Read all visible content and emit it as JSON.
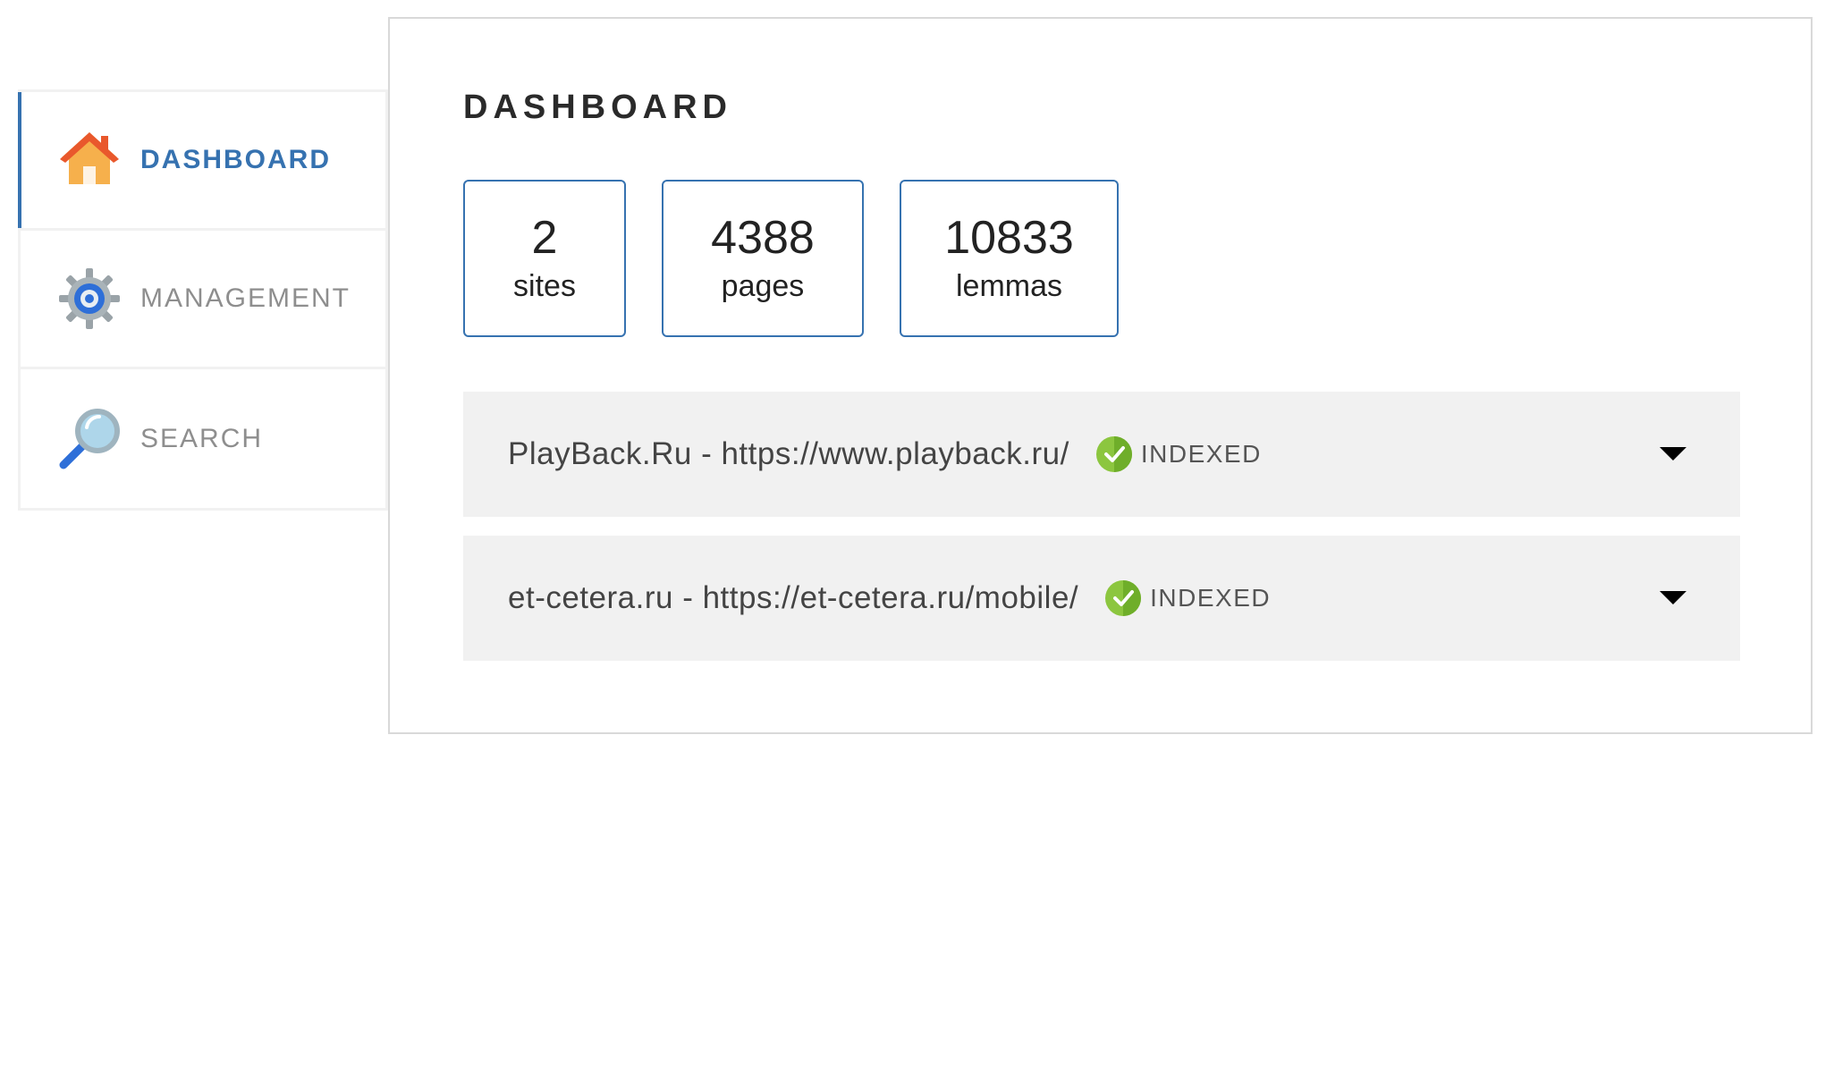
{
  "nav": {
    "items": [
      {
        "label": "DASHBOARD",
        "icon": "home-icon",
        "active": true
      },
      {
        "label": "MANAGEMENT",
        "icon": "gear-icon",
        "active": false
      },
      {
        "label": "SEARCH",
        "icon": "magnifier-icon",
        "active": false
      }
    ]
  },
  "main": {
    "title": "DASHBOARD",
    "stats": [
      {
        "value": "2",
        "label": "sites"
      },
      {
        "value": "4388",
        "label": "pages"
      },
      {
        "value": "10833",
        "label": "lemmas"
      }
    ],
    "sites": [
      {
        "text": "PlayBack.Ru - https://www.playback.ru/",
        "status": "INDEXED"
      },
      {
        "text": "et-cetera.ru - https://et-cetera.ru/mobile/",
        "status": "INDEXED"
      }
    ]
  },
  "colors": {
    "accent": "#3672b0",
    "status_ok": "#8cc63f",
    "row_bg": "#f1f1f1"
  }
}
